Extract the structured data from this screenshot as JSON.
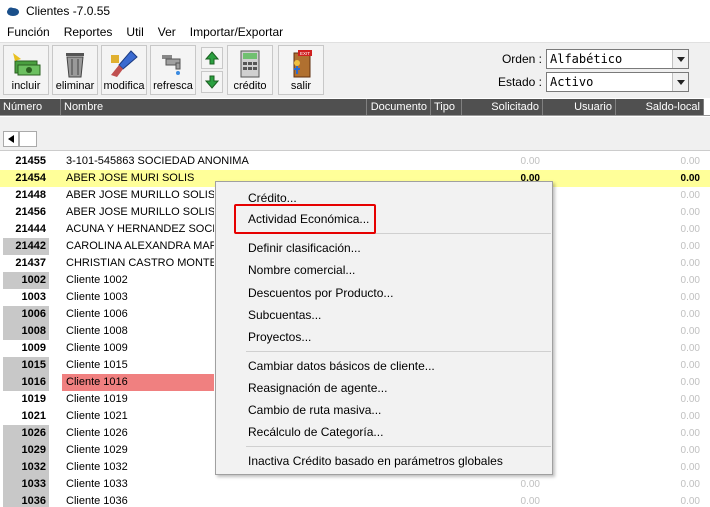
{
  "window": {
    "title": "Clientes -7.0.55"
  },
  "menu": [
    "Función",
    "Reportes",
    "Util",
    "Ver",
    "Importar/Exportar"
  ],
  "toolbar": {
    "incluir": "incluir",
    "eliminar": "eliminar",
    "modifica": "modifica",
    "refresca": "refresca",
    "credito": "crédito",
    "salir": "salir",
    "exit_sign": "EXIT"
  },
  "filters": {
    "orden_label": "Orden :",
    "orden_value": "Alfabético",
    "estado_label": "Estado :",
    "estado_value": "Activo"
  },
  "columns": {
    "numero": "Número",
    "nombre": "Nombre",
    "documento": "Documento",
    "tipo": "Tipo",
    "solicitado": "Solicitado",
    "usuario": "Usuario",
    "saldo": "Saldo-local"
  },
  "rows": [
    {
      "num": "21455",
      "name": "3-101-545863 SOCIEDAD ANONIMA",
      "sol": "0.00",
      "sal": "0.00"
    },
    {
      "num": "21454",
      "name": "ABER JOSE MURI SOLIS",
      "sol": "0.00",
      "sal": "0.00"
    },
    {
      "num": "21448",
      "name": "ABER JOSE MURILLO SOLIS",
      "sol": "",
      "sal": "0.00"
    },
    {
      "num": "21456",
      "name": "ABER JOSE MURILLO SOLIS",
      "sol": "",
      "sal": "0.00"
    },
    {
      "num": "21444",
      "name": "ACUNA Y HERNANDEZ SOCIEDAD",
      "sol": "",
      "sal": "0.00"
    },
    {
      "num": "21442",
      "name": "CAROLINA ALEXANDRA MARIN",
      "sol": "",
      "sal": "0.00"
    },
    {
      "num": "21437",
      "name": "CHRISTIAN CASTRO MONTERO",
      "sol": "",
      "sal": "0.00"
    },
    {
      "num": "1002",
      "name": "Cliente 1002",
      "sol": "",
      "sal": "0.00"
    },
    {
      "num": "1003",
      "name": "Cliente 1003",
      "sol": "",
      "sal": "0.00"
    },
    {
      "num": "1006",
      "name": "Cliente 1006",
      "sol": "",
      "sal": "0.00"
    },
    {
      "num": "1008",
      "name": "Cliente 1008",
      "sol": "",
      "sal": "0.00"
    },
    {
      "num": "1009",
      "name": "Cliente 1009",
      "sol": "",
      "sal": "0.00"
    },
    {
      "num": "1015",
      "name": "Cliente 1015",
      "sol": "",
      "sal": "0.00"
    },
    {
      "num": "1016",
      "name": "Cliente 1016",
      "sol": "",
      "sal": "0.00"
    },
    {
      "num": "1019",
      "name": "Cliente 1019",
      "sol": "",
      "sal": "0.00"
    },
    {
      "num": "1021",
      "name": "Cliente 1021",
      "sol": "",
      "sal": "0.00"
    },
    {
      "num": "1026",
      "name": "Cliente 1026",
      "sol": "",
      "sal": "0.00"
    },
    {
      "num": "1029",
      "name": "Cliente 1029",
      "sol": "",
      "sal": "0.00"
    },
    {
      "num": "1032",
      "name": "Cliente 1032",
      "sol": "",
      "sal": "0.00"
    },
    {
      "num": "1033",
      "name": "Cliente 1033",
      "sol": "0.00",
      "sal": "0.00"
    },
    {
      "num": "1036",
      "name": "Cliente 1036",
      "sol": "0.00",
      "sal": "0.00"
    }
  ],
  "context_menu": {
    "credito": "Crédito...",
    "actividad": "Actividad Económica...",
    "definir": "Definir clasificación...",
    "nombre_comercial": "Nombre comercial...",
    "descuentos": "Descuentos por Producto...",
    "subcuentas": "Subcuentas...",
    "proyectos": "Proyectos...",
    "cambiar_datos": "Cambiar datos básicos de cliente...",
    "reasignacion": "Reasignación de agente...",
    "cambio_ruta": "Cambio de ruta masiva...",
    "recalculo": "Recálculo de Categoría...",
    "inactiva": "Inactiva Crédito basado en parámetros globales"
  },
  "colors": {
    "selected_row": "#ffff99",
    "flagged_name": "#f08080",
    "highlight_border": "#e60000",
    "header_bg": "#505050"
  }
}
